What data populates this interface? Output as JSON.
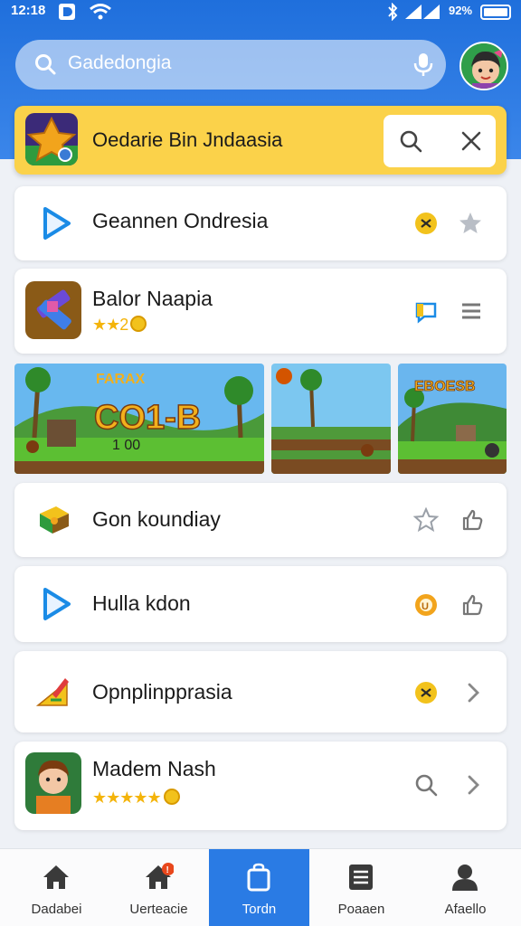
{
  "status_bar": {
    "time": "12:18",
    "battery_text": "92%"
  },
  "search": {
    "placeholder": "Gadedongia"
  },
  "featured": {
    "title": "Oedarie Bin Jndaasia"
  },
  "items": [
    {
      "title": "Geannen Ondresia"
    },
    {
      "title": "Balor Naapia",
      "rating": "★★2",
      "rating_stars": 2
    },
    {
      "title": "Gon koundiay"
    },
    {
      "title": "Hulla kdon"
    },
    {
      "title": "Opnplinpprasia"
    },
    {
      "title": "Madem Nash",
      "rating": "★★★★★",
      "rating_stars": 4.5
    }
  ],
  "screenshots": [
    {
      "banner": "FARAX",
      "score_title": "CO1-B",
      "score": "1 00"
    },
    {
      "banner": ""
    },
    {
      "banner": "EBOESB"
    }
  ],
  "nav": [
    {
      "label": "Dadabei",
      "icon": "home-icon"
    },
    {
      "label": "Uerteacie",
      "icon": "home-badge-icon"
    },
    {
      "label": "Tordn",
      "icon": "bag-icon",
      "active": true
    },
    {
      "label": "Poaaen",
      "icon": "list-icon"
    },
    {
      "label": "Afaello",
      "icon": "person-icon"
    }
  ],
  "colors": {
    "header_blue": "#1f6fdc",
    "featured_yellow": "#fbd24a",
    "active_nav": "#2a7be4",
    "star": "#f4b40a"
  }
}
